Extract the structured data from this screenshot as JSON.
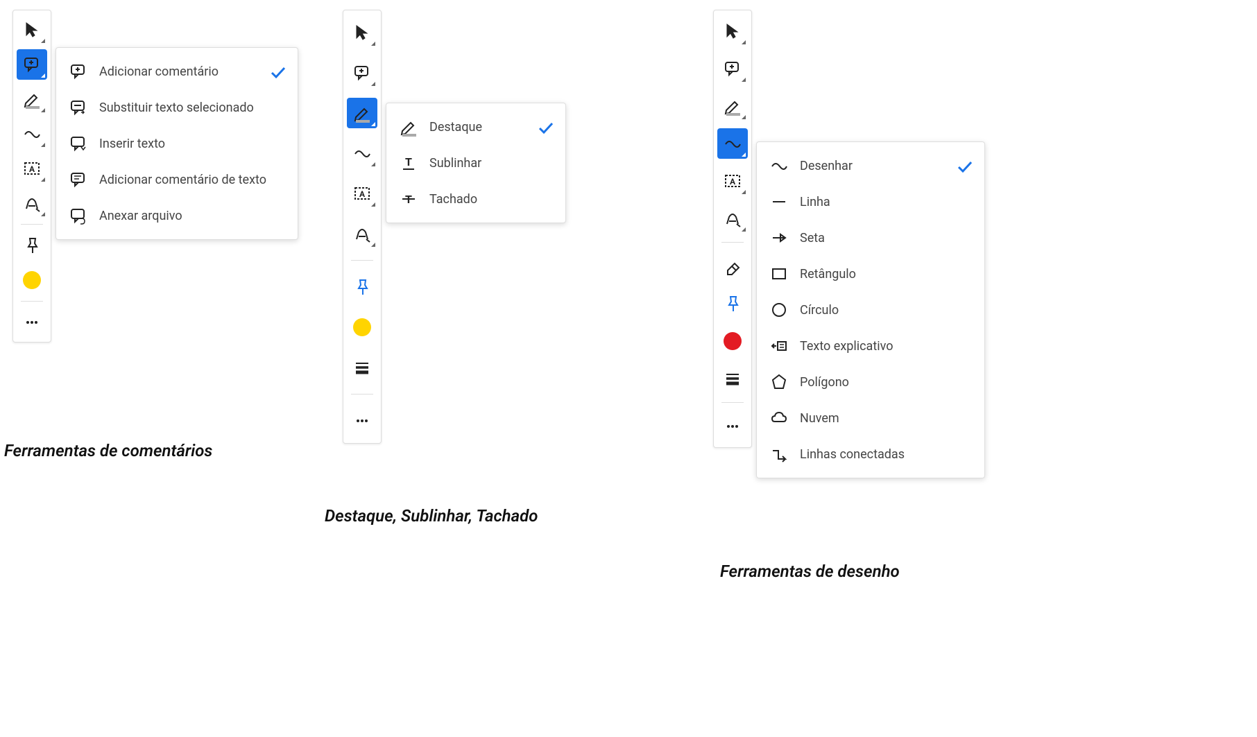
{
  "panels": {
    "comments": {
      "caption": "Ferramentas de comentários",
      "color_swatch": "#FFD400",
      "menu": [
        {
          "label": "Adicionar comentário",
          "icon": "add-comment",
          "checked": true
        },
        {
          "label": "Substituir texto selecionado",
          "icon": "replace-text",
          "checked": false
        },
        {
          "label": "Inserir texto",
          "icon": "insert-text",
          "checked": false
        },
        {
          "label": "Adicionar comentário de texto",
          "icon": "text-comment",
          "checked": false
        },
        {
          "label": "Anexar arquivo",
          "icon": "attach-file",
          "checked": false
        }
      ]
    },
    "highlight": {
      "caption": "Destaque, Sublinhar, Tachado",
      "color_swatch": "#FFD400",
      "menu": [
        {
          "label": "Destaque",
          "icon": "highlight",
          "checked": true
        },
        {
          "label": "Sublinhar",
          "icon": "underline",
          "checked": false
        },
        {
          "label": "Tachado",
          "icon": "strikethrough",
          "checked": false
        }
      ]
    },
    "drawing": {
      "caption": "Ferramentas de desenho",
      "color_swatch": "#E31B23",
      "menu": [
        {
          "label": "Desenhar",
          "icon": "freehand",
          "checked": true
        },
        {
          "label": "Linha",
          "icon": "line",
          "checked": false
        },
        {
          "label": "Seta",
          "icon": "arrow",
          "checked": false
        },
        {
          "label": "Retângulo",
          "icon": "rectangle",
          "checked": false
        },
        {
          "label": "Círculo",
          "icon": "circle",
          "checked": false
        },
        {
          "label": "Texto explicativo",
          "icon": "callout",
          "checked": false
        },
        {
          "label": "Polígono",
          "icon": "polygon",
          "checked": false
        },
        {
          "label": "Nuvem",
          "icon": "cloud",
          "checked": false
        },
        {
          "label": "Linhas conectadas",
          "icon": "connected-lines",
          "checked": false
        }
      ]
    }
  }
}
